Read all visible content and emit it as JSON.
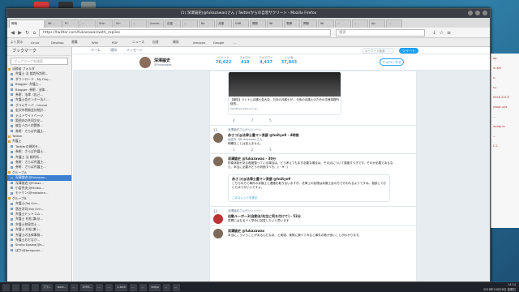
{
  "window": {
    "title": "(1) 深澤諭史(@fukazawas)さん | Twitterからの自習サクリート - Mozilla Firefox"
  },
  "tabs": [
    "概略",
    "Wi...",
    "PC",
    "…",
    "Shin",
    "Sin",
    "…",
    "/home...",
    "自習",
    "…",
    "Ro",
    "弁護",
    "GitR",
    "開発",
    "Wi",
    "電網",
    "問題",
    "Wi",
    "…",
    "…",
    "Ap",
    "…"
  ],
  "url": {
    "value": "https://twitter.com/fukazawas/with_replies",
    "search_placeholder": "検索"
  },
  "bookmarks_bar": [
    "よく見る",
    "Linux",
    "Desktop",
    "書籍",
    "Wiki",
    "PDF",
    "ニュース",
    "自習",
    "開発",
    "Amazon",
    "Google",
    "…"
  ],
  "sidebar": {
    "header": "ブックマーク",
    "search_placeholder": "ブックマークを検索",
    "items": [
      {
        "label": "法務省 フォルダ",
        "folder": true
      },
      {
        "label": "弁護士 法 裁判所判例...",
        "folder": false
      },
      {
        "label": "ダウンロード - My Proj...",
        "folder": false
      },
      {
        "label": "Blogger: 弁護士...",
        "folder": false
      },
      {
        "label": "Blogger: 券術 - 法律...",
        "folder": false
      },
      {
        "label": "券術：法律（自己...",
        "folder": false
      },
      {
        "label": "弁護士会センター法人...",
        "folder": false
      },
      {
        "label": "グラムサーバ - hinono",
        "folder": false
      },
      {
        "label": "金沢市税務会計統計...",
        "folder": false
      },
      {
        "label": "テストサイトページ",
        "folder": false
      },
      {
        "label": "範囲内の共同文化...",
        "folder": false
      },
      {
        "label": "被告人の人的関係...",
        "folder": false
      },
      {
        "label": "券術：さらば弁護士...",
        "folder": false
      },
      {
        "label": "Twitter",
        "folder": true
      },
      {
        "label": "弁護士",
        "folder": true
      },
      {
        "label": "Twitterの規則を...",
        "folder": false
      },
      {
        "label": "券術：さらば弁護士...",
        "folder": false
      },
      {
        "label": "弁護士 法 裁判所...",
        "folder": false
      },
      {
        "label": "券術：さらば弁護士...",
        "folder": false
      },
      {
        "label": "券術：さらば弁護士...",
        "folder": false
      },
      {
        "label": "グループA",
        "folder": true
      },
      {
        "label": "深澤諭史(@fukazaw...",
        "folder": false,
        "selected": true
      },
      {
        "label": "深澤諭史(@Fukaz...",
        "folder": false
      },
      {
        "label": "小倉秀夫(@Hideo...",
        "folder": false
      },
      {
        "label": "モトケン(@motoken...",
        "folder": false
      },
      {
        "label": "グループB",
        "folder": true
      },
      {
        "label": "弁護士(Yoj Och...",
        "folder": false
      },
      {
        "label": "落合洋司(Yoji Och...",
        "folder": false
      },
      {
        "label": "弁護士ドットコム...",
        "folder": false
      },
      {
        "label": "弁護士 村松 謙(@...",
        "folder": false
      },
      {
        "label": "弁護士和泉貴士...",
        "folder": false
      },
      {
        "label": "弁護士 村松 謙 (...",
        "folder": false
      },
      {
        "label": "弁護士の法律事務...",
        "folder": false
      },
      {
        "label": "弁護士おだなか...",
        "folder": false
      },
      {
        "label": "Shoko Egawa(@s...",
        "folder": false
      },
      {
        "label": "ほか(@bengoshi...",
        "folder": false
      }
    ]
  },
  "twitter": {
    "nav": [
      "ホーム",
      "通知",
      "メッセージ"
    ],
    "search_placeholder": "キーワード検索",
    "tweet_button": "ツイート",
    "profile": {
      "name": "深澤諭史",
      "handle": "@fukazawas",
      "stats": [
        {
          "label": "ツイート",
          "value": "76,622"
        },
        {
          "label": "フォロー",
          "value": "418"
        },
        {
          "label": "フォロワー",
          "value": "4,437"
        },
        {
          "label": "いいね",
          "value": "37,843"
        }
      ],
      "follow_label": "フォローする"
    },
    "card": {
      "text": "【報告】ベトナム弁護士会大会 - 日本の弁護士が... 今後の弁護士のための法律事務所経営...",
      "url": "headlines.yahoo.co.jp"
    },
    "card_actions": [
      "4",
      "7",
      "5"
    ],
    "tweet1": {
      "number": "13",
      "context": "深澤諭史さんがリツイート",
      "name": "赤さコ(@法律士量マン男爵 @hoityo9 - 4時間",
      "reply": "返信先: @fukazawas さん",
      "text": "明確なことは言えません。"
    },
    "tweet1_actions": [
      "1",
      "2",
      "3"
    ],
    "tweet2": {
      "name": "深澤諭史 @fukazawas - 30分",
      "text": "防衛体制がある程度整っている場合は、どう考えてもまず必要な場合は、その点について調査すべきです。それが必要であるなら、本当に必要かどうか判断すべき。(;・∀・)"
    },
    "quote": {
      "name": "赤さコ(@法律士量マン男爵 @hoityo9",
      "text": "こちらの方で事件の弁護士と連絡を取り合いますが、法律上の処理は弁護士会の方で行われるようですね。相談しておいたほうがいいですよ。",
      "more": "このスレッドを表示"
    },
    "tweet3": {
      "number": "13",
      "context": "深澤諭史さんがリツイート",
      "name": "自動ルーボー3(自動法/先生に気を付けて) - 52分",
      "text": "質問にはなるべく早めに回答したいと思います"
    },
    "tweet4": {
      "name": "深澤諭史 @fukazawas",
      "text": "本当にこういうことがあるんだなあ、と実感。実際に調べてみると事件の数が多いことがわかります。"
    }
  },
  "right_strip": [
    "ep-",
    "in-Ker",
    "s:",
    "ry-",
    "0918-2017(",
    "ykogr-una",
    "...",
    "wyogi-ts",
    "...",
    "C-1"
  ],
  "taskbar": {
    "items": [
      "",
      "",
      "",
      "",
      "プラ...",
      "work...",
      "...",
      "1993...",
      "...",
      "...",
      "x-tack",
      "...",
      "...",
      "vlego",
      "...",
      "..."
    ],
    "time": "14:14",
    "date": "2018年10月26日 金曜日"
  },
  "desktop_icons": [
    {
      "color": "#d23a3a"
    },
    {
      "color": "#3a3a3a"
    },
    {
      "color": "#7a8a8a"
    }
  ]
}
